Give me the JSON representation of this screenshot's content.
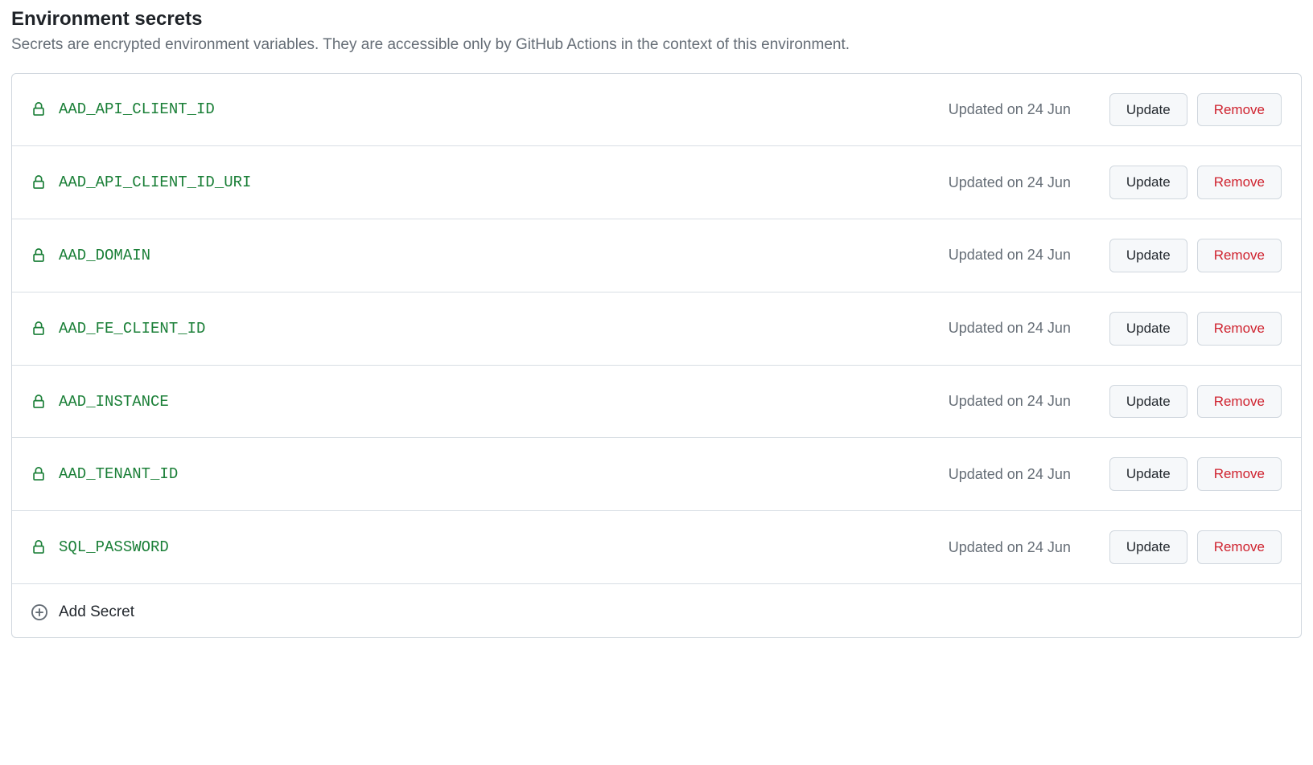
{
  "header": {
    "title": "Environment secrets",
    "description": "Secrets are encrypted environment variables. They are accessible only by GitHub Actions in the context of this environment."
  },
  "buttons": {
    "update_label": "Update",
    "remove_label": "Remove",
    "add_secret_label": "Add Secret"
  },
  "secrets": [
    {
      "name": "AAD_API_CLIENT_ID",
      "updated": "Updated on 24 Jun"
    },
    {
      "name": "AAD_API_CLIENT_ID_URI",
      "updated": "Updated on 24 Jun"
    },
    {
      "name": "AAD_DOMAIN",
      "updated": "Updated on 24 Jun"
    },
    {
      "name": "AAD_FE_CLIENT_ID",
      "updated": "Updated on 24 Jun"
    },
    {
      "name": "AAD_INSTANCE",
      "updated": "Updated on 24 Jun"
    },
    {
      "name": "AAD_TENANT_ID",
      "updated": "Updated on 24 Jun"
    },
    {
      "name": "SQL_PASSWORD",
      "updated": "Updated on 24 Jun"
    }
  ]
}
